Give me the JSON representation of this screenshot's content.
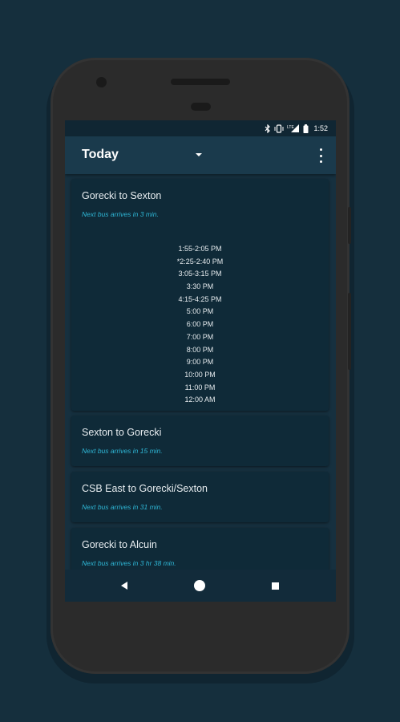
{
  "status_bar": {
    "time": "1:52",
    "icons": [
      "bluetooth-icon",
      "vibrate-icon",
      "lte-signal-icon",
      "battery-icon"
    ],
    "network_label": "LTE"
  },
  "app_bar": {
    "title": "Today",
    "dropdown_icon": "dropdown-arrow-icon",
    "menu_icon": "overflow-menu-icon"
  },
  "routes": [
    {
      "name": "Gorecki to Sexton",
      "next_bus": "Next bus arrives in 3 min.",
      "times": [
        "1:55-2:05 PM",
        "*2:25-2:40 PM",
        "3:05-3:15 PM",
        "3:30 PM",
        "4:15-4:25 PM",
        "5:00 PM",
        "6:00 PM",
        "7:00 PM",
        "8:00 PM",
        "9:00 PM",
        "10:00 PM",
        "11:00 PM",
        "12:00 AM"
      ]
    },
    {
      "name": "Sexton to Gorecki",
      "next_bus": "Next bus arrives in 15 min."
    },
    {
      "name": "CSB East to Gorecki/Sexton",
      "next_bus": "Next bus arrives in 31 min."
    },
    {
      "name": "Gorecki to Alcuin",
      "next_bus": "Next bus arrives in 3 hr 38 min."
    }
  ],
  "nav_bar": {
    "buttons": [
      "back-icon",
      "home-icon",
      "recents-icon"
    ]
  },
  "colors": {
    "background": "#152f3d",
    "accent": "#2fb7d6",
    "card": "#0f2a38",
    "app_bar": "#1a3a4c"
  }
}
